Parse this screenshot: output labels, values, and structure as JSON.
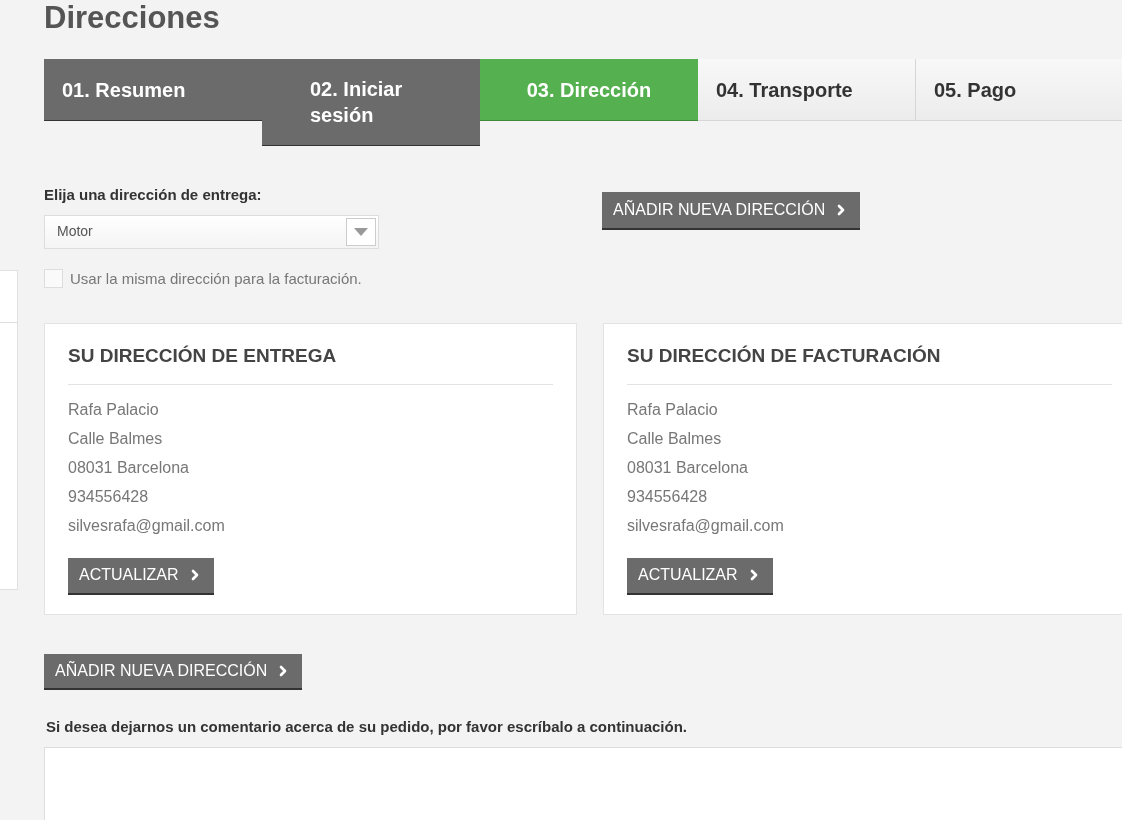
{
  "page_title": "Direcciones",
  "steps": [
    {
      "label": "01. Resumen",
      "kind": "done"
    },
    {
      "label": "02. Iniciar sesión",
      "kind": "done"
    },
    {
      "label": "03. Dirección",
      "kind": "current"
    },
    {
      "label": "04. Transporte",
      "kind": "todo"
    },
    {
      "label": "05. Pago",
      "kind": "todo"
    }
  ],
  "delivery_select": {
    "label": "Elija una dirección de entrega:",
    "value": "Motor"
  },
  "same_address": {
    "label": "Usar la misma dirección para la facturación.",
    "checked": false
  },
  "top_add_button": "AÑADIR NUEVA DIRECCIÓN",
  "address_cards": [
    {
      "title": "SU DIRECCIÓN DE ENTREGA",
      "lines": [
        "Rafa Palacio",
        "Calle Balmes",
        "08031 Barcelona",
        "934556428",
        "silvesrafa@gmail.com"
      ],
      "button": "ACTUALIZAR"
    },
    {
      "title": "SU DIRECCIÓN DE FACTURACIÓN",
      "lines": [
        "Rafa Palacio",
        "Calle Balmes",
        "08031 Barcelona",
        "934556428",
        "silvesrafa@gmail.com"
      ],
      "button": "ACTUALIZAR"
    }
  ],
  "bottom_add_button": "AÑADIR NUEVA DIRECCIÓN",
  "comment": {
    "label": "Si desea dejarnos un comentario acerca de su pedido, por favor escríbalo a continuación."
  }
}
